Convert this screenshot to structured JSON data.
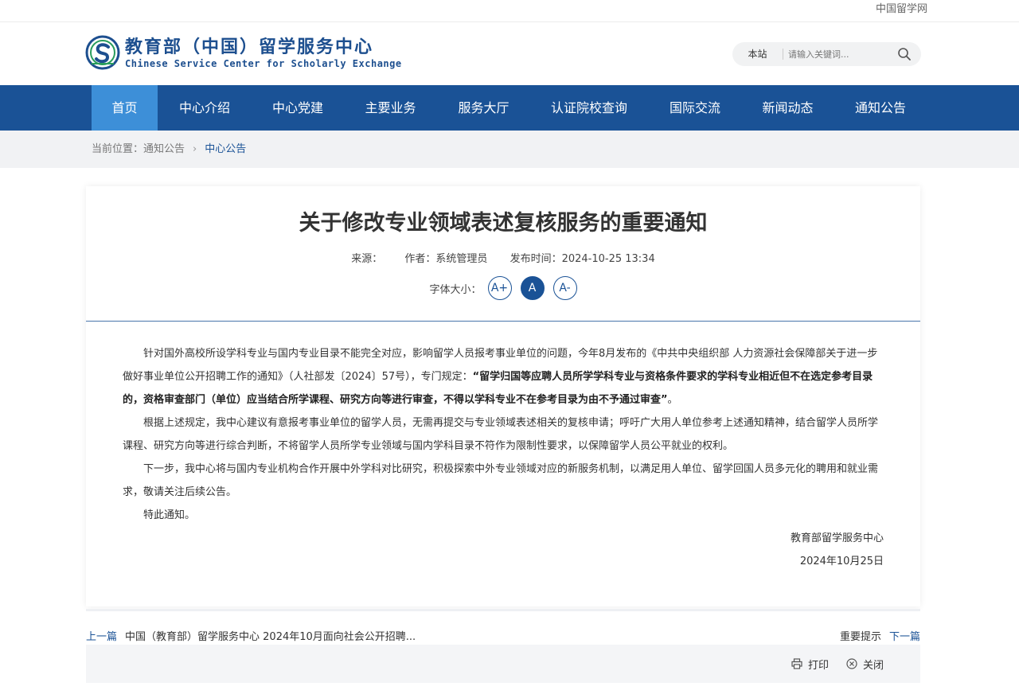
{
  "topbar": {
    "site_link": "中国留学网"
  },
  "logo": {
    "cn": "教育部（中国）留学服务中心",
    "en": "Chinese Service Center for Scholarly Exchange"
  },
  "search": {
    "scope": "本站",
    "placeholder": "请输入关键词..."
  },
  "nav": {
    "items": [
      {
        "label": "首页",
        "width": 83
      },
      {
        "label": "中心介绍",
        "width": 118
      },
      {
        "label": "中心党建",
        "width": 116
      },
      {
        "label": "主要业务",
        "width": 117
      },
      {
        "label": "服务大厅",
        "width": 117
      },
      {
        "label": "认证院校查询",
        "width": 148
      },
      {
        "label": "国际交流",
        "width": 118
      },
      {
        "label": "新闻动态",
        "width": 115
      },
      {
        "label": "通知公告",
        "width": 118
      }
    ]
  },
  "breadcrumb": {
    "prefix": "当前位置：",
    "parent": "通知公告",
    "current": "中心公告"
  },
  "article": {
    "title": "关于修改专业领域表述复核服务的重要通知",
    "source": "来源：",
    "author": "作者：系统管理员",
    "date": "发布时间：2024-10-25 13:34",
    "fontsize_label": "字体大小：",
    "fs_increase": "A+",
    "fs_normal": "A",
    "fs_decrease": "A-",
    "p1_normal": "针对国外高校所设学科专业与国内专业目录不能完全对应，影响留学人员报考事业单位的问题，今年8月发布的《中共中央组织部 人力资源社会保障部关于进一步做好事业单位公开招聘工作的通知》（人社部发〔2024〕57号），专门规定：",
    "p1_bold": "“留学归国等应聘人员所学学科专业与资格条件要求的学科专业相近但不在选定参考目录的，资格审查部门（单位）应当结合所学课程、研究方向等进行审查，不得以学科专业不在参考目录为由不予通过审查”",
    "p1_end": "。",
    "p2": "根据上述规定，我中心建议有意报考事业单位的留学人员，无需再提交与专业领域表述相关的复核申请；呼吁广大用人单位参考上述通知精神，结合留学人员所学课程、研究方向等进行综合判断，不将留学人员所学专业领域与国内学科目录不符作为限制性要求，以保障留学人员公平就业的权利。",
    "p3": "下一步，我中心将与国内专业机构合作开展中外学科对比研究，积极探索中外专业领域对应的新服务机制，以满足用人单位、留学回国人员多元化的聘用和就业需求，敬请关注后续公告。",
    "p4": "特此通知。",
    "sign_org": "教育部留学服务中心",
    "sign_date": "2024年10月25日"
  },
  "pager": {
    "prev_label": "上一篇",
    "prev_title": "中国（教育部）留学服务中心 2024年10月面向社会公开招聘...",
    "next_title": "重要提示",
    "next_label": "下一篇"
  },
  "tools": {
    "print": "打印",
    "close": "关闭"
  },
  "colors": {
    "brand": "#1a5296",
    "nav_active": "#3d8fd8"
  }
}
